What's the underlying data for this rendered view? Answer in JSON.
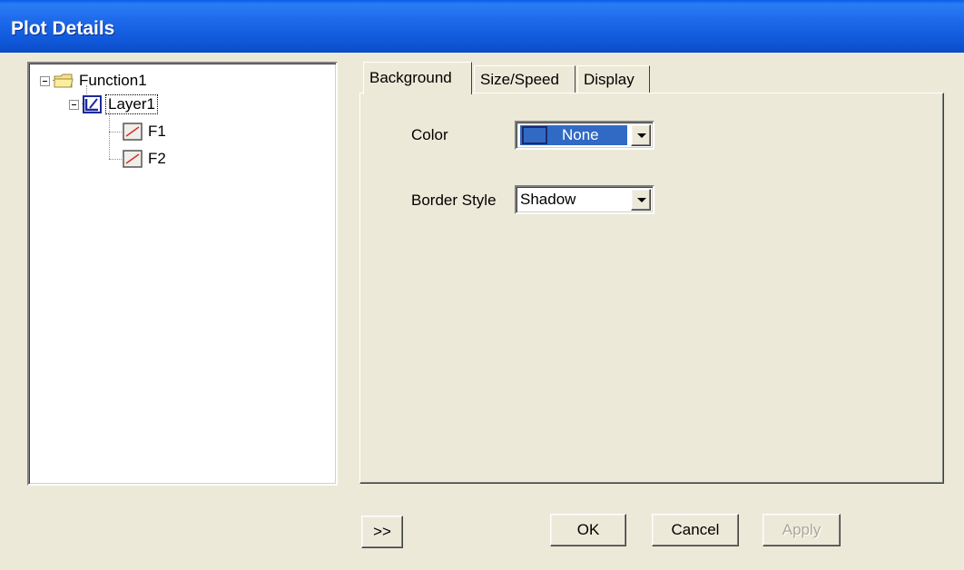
{
  "window": {
    "title": "Plot Details"
  },
  "tree": {
    "root": {
      "label": "Function1"
    },
    "layer": {
      "label": "Layer1"
    },
    "plots": [
      {
        "label": "F1"
      },
      {
        "label": "F2"
      }
    ]
  },
  "tabs": [
    {
      "label": "Background",
      "active": true
    },
    {
      "label": "Size/Speed",
      "active": false
    },
    {
      "label": "Display",
      "active": false
    }
  ],
  "background": {
    "color_label": "Color",
    "color_value": "None",
    "border_label": "Border Style",
    "border_value": "Shadow"
  },
  "buttons": {
    "expand": ">>",
    "ok": "OK",
    "cancel": "Cancel",
    "apply": "Apply"
  },
  "colors": {
    "titlebar": "#0a5ee8",
    "dialog_bg": "#ece9d8",
    "selection": "#316ac5"
  }
}
